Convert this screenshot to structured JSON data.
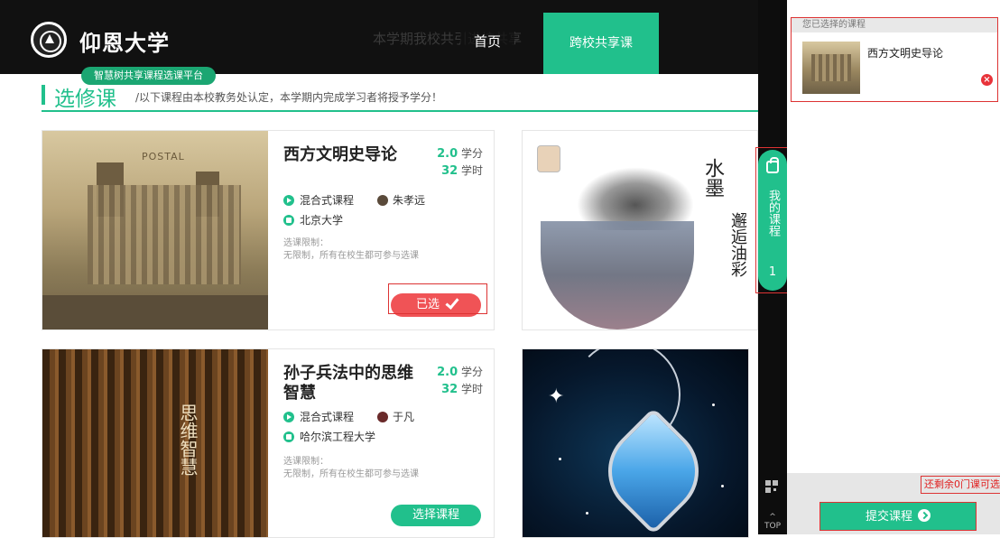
{
  "header": {
    "university": "仰恩大学",
    "ticker": "本学期我校共引进校共享",
    "nav_home": "首页",
    "nav_cross": "跨校共享课",
    "platform_badge": "智慧树共享课程选课平台"
  },
  "section": {
    "title": "选修课",
    "note": "/以下课程由本校教务处认定，本学期内完成学习者将授予学分！"
  },
  "courses": [
    {
      "title": "西方文明史导论",
      "credits": "2.0",
      "credit_unit": "学分",
      "hours": "32",
      "hour_unit": "学时",
      "type": "混合式课程",
      "teacher": "朱孝远",
      "school": "北京大学",
      "limit_label": "选课限制：",
      "limit_text": "无限制，所有在校生都可参与选课",
      "image_stamp": "POSTAL",
      "button": "已选"
    },
    {
      "title": "孙子兵法中的思维智慧",
      "credits": "2.0",
      "credit_unit": "学分",
      "hours": "32",
      "hour_unit": "学时",
      "type": "混合式课程",
      "teacher": "于凡",
      "school": "哈尔滨工程大学",
      "limit_label": "选课限制：",
      "limit_text": "无限制，所有在校生都可参与选课",
      "image_text": "思维智慧",
      "button": "选择课程"
    }
  ],
  "ink_card": {
    "text_main": "水墨",
    "text_sub": "邂逅油彩"
  },
  "rail": {
    "my_courses": "我的课程",
    "count": "1",
    "top": "TOP"
  },
  "panel": {
    "heading": "您已选择的课程",
    "selected_course": "西方文明史导论",
    "remaining": "还剩余0门课可选",
    "submit": "提交课程"
  },
  "colors": {
    "accent": "#21c08c",
    "chosen": "#f05356",
    "outline": "#dd3333"
  }
}
